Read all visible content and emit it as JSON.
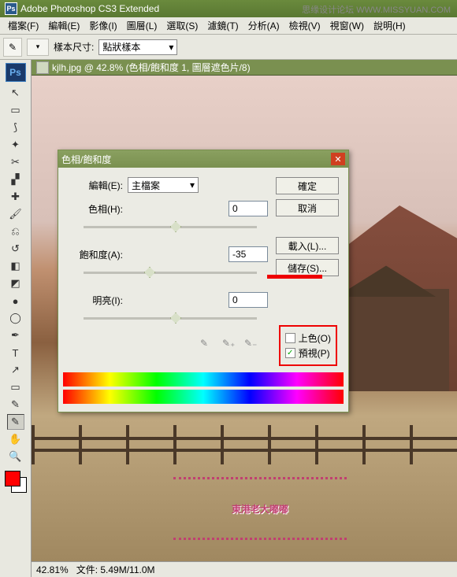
{
  "app": {
    "title": "Adobe Photoshop CS3 Extended",
    "watermark": "思缘设计论坛 WWW.MISSYUAN.COM"
  },
  "menu": {
    "file": "檔案(F)",
    "edit": "編輯(E)",
    "image": "影像(I)",
    "layer": "圖層(L)",
    "select": "選取(S)",
    "filter": "濾鏡(T)",
    "analysis": "分析(A)",
    "view": "檢視(V)",
    "window": "視窗(W)",
    "help": "說明(H)"
  },
  "options": {
    "label": "樣本尺寸:",
    "value": "點狀樣本"
  },
  "doc": {
    "title": "kjlh.jpg @ 42.8% (色相/飽和度 1, 圖層遮色片/8)"
  },
  "status": {
    "zoom": "42.81%",
    "info": "文件: 5.49M/11.0M"
  },
  "dialog": {
    "title": "色相/飽和度",
    "edit_label": "編輯(E):",
    "edit_value": "主檔案",
    "hue_label": "色相(H):",
    "hue_value": "0",
    "sat_label": "飽和度(A):",
    "sat_value": "-35",
    "light_label": "明亮(I):",
    "light_value": "0",
    "ok": "確定",
    "cancel": "取消",
    "load": "載入(L)...",
    "save": "儲存(S)...",
    "colorize": "上色(O)",
    "preview": "預視(P)"
  },
  "deco": "東港老大嘟嘟"
}
